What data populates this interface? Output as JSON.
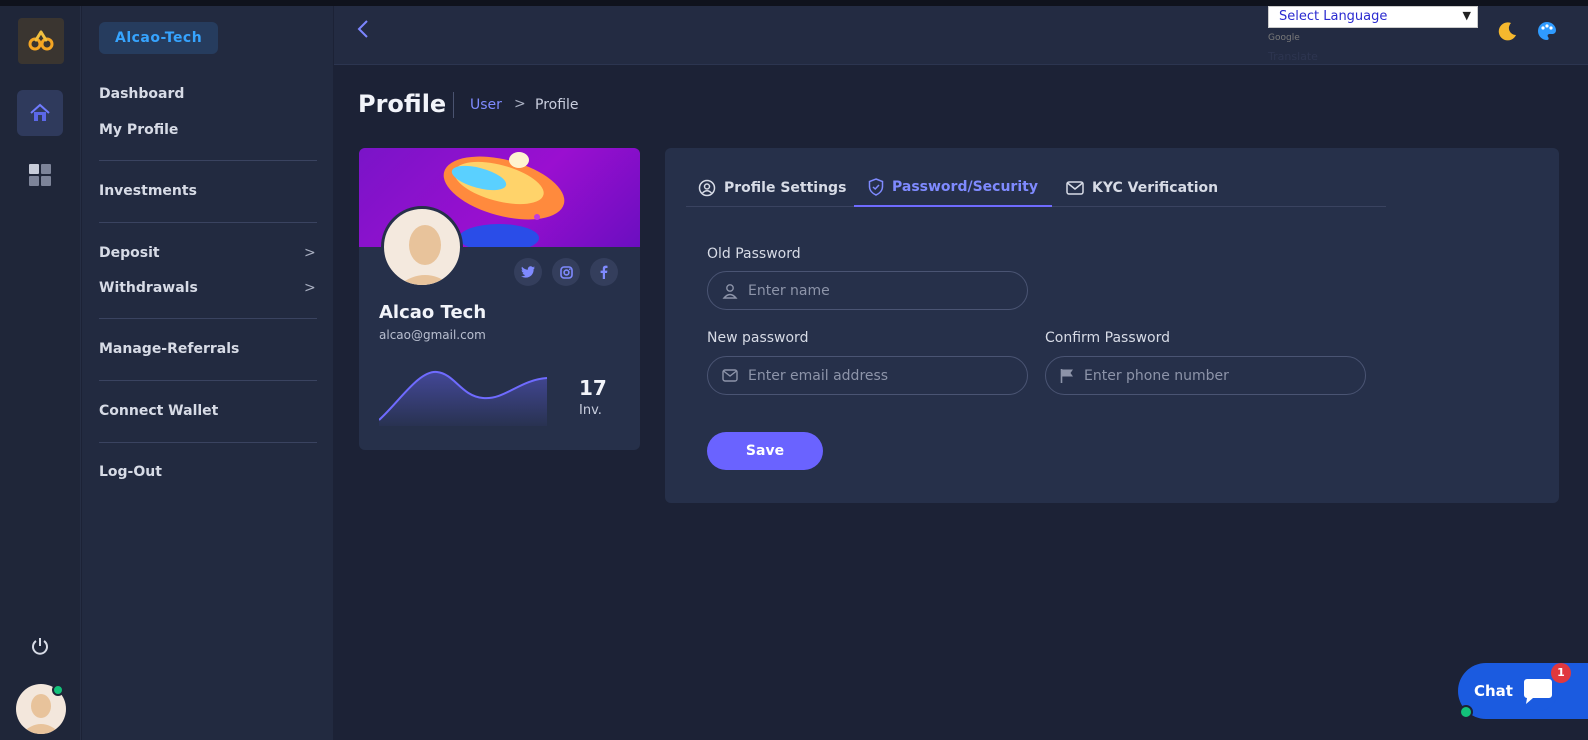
{
  "brand": {
    "name": "Alcao-Tech"
  },
  "sidebar": {
    "items": [
      {
        "label": "Dashboard"
      },
      {
        "label": "My Profile"
      },
      {
        "label": "Investments"
      },
      {
        "label": "Deposit"
      },
      {
        "label": "Withdrawals"
      },
      {
        "label": "Manage-Referrals"
      },
      {
        "label": "Connect Wallet"
      },
      {
        "label": "Log-Out"
      }
    ]
  },
  "topbar": {
    "language_select": "Select Language",
    "google_label": "Google",
    "translate_label": "Translate"
  },
  "page": {
    "title": "Profile",
    "breadcrumb": {
      "parent": "User",
      "separator": ">",
      "current": "Profile"
    }
  },
  "profile_card": {
    "name": "Alcao Tech",
    "email": "alcao@gmail.com",
    "investments_count": "17",
    "investments_label": "Inv.",
    "social": [
      "twitter-icon",
      "instagram-icon",
      "facebook-icon"
    ]
  },
  "tabs": [
    {
      "label": "Profile Settings",
      "icon": "user-circle-icon"
    },
    {
      "label": "Password/Security",
      "icon": "shield-icon",
      "active": true
    },
    {
      "label": "KYC Verification",
      "icon": "mail-icon"
    }
  ],
  "form": {
    "old_password": {
      "label": "Old Password",
      "placeholder": "Enter name"
    },
    "new_password": {
      "label": "New password",
      "placeholder": "Enter email address"
    },
    "confirm_password": {
      "label": "Confirm Password",
      "placeholder": "Enter phone number"
    },
    "save_label": "Save"
  },
  "chat": {
    "label": "Chat",
    "badge": "1"
  },
  "colors": {
    "accent": "#6a63ff",
    "brand": "#36a4ff",
    "online": "#13c27a",
    "chat": "#1b5be0"
  }
}
